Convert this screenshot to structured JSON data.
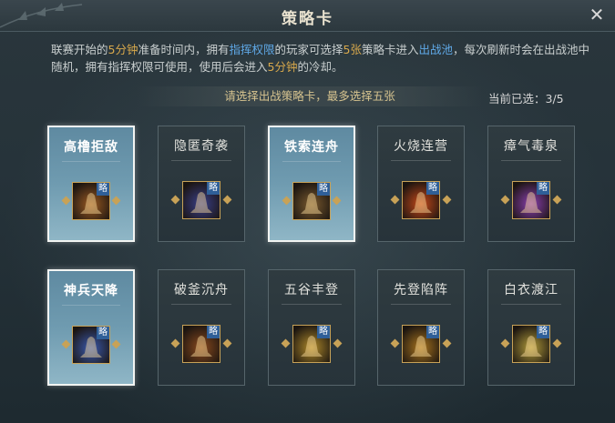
{
  "window": {
    "title": "策略卡"
  },
  "description": {
    "p1": "联赛开始的",
    "t1": "5分钟",
    "p2": "准备时间内，拥有",
    "t2": "指挥权限",
    "p3": "的玩家可选择",
    "t3": "5张",
    "p4": "策略卡进入",
    "t4": "出战池",
    "p5": "，每次刷新时会在出战池中随机，拥有指挥权限可使用，使用后会进入",
    "t5": "5分钟",
    "p6": "的冷却。"
  },
  "prompt": "请选择出战策略卡，最多选择五张",
  "selection": {
    "label": "当前已选：",
    "value": "3/5"
  },
  "badge_label": "略",
  "cards": [
    {
      "name": "高橹拒敌",
      "selected": true,
      "icon": "tower-icon",
      "hue": "#9a5a22"
    },
    {
      "name": "隐匿奇袭",
      "selected": false,
      "icon": "shadow-icon",
      "hue": "#3a3f8a"
    },
    {
      "name": "铁索连舟",
      "selected": true,
      "icon": "soldiers-icon",
      "hue": "#7a5a2e"
    },
    {
      "name": "火烧连营",
      "selected": false,
      "icon": "fire-icon",
      "hue": "#c4481a"
    },
    {
      "name": "瘴气毒泉",
      "selected": false,
      "icon": "poison-icon",
      "hue": "#8a3fb0"
    },
    {
      "name": "神兵天降",
      "selected": true,
      "icon": "descend-icon",
      "hue": "#3a5ab0"
    },
    {
      "name": "破釜沉舟",
      "selected": false,
      "icon": "cauldron-icon",
      "hue": "#8a4a1e"
    },
    {
      "name": "五谷丰登",
      "selected": false,
      "icon": "harvest-icon",
      "hue": "#b08a2a"
    },
    {
      "name": "先登陷阵",
      "selected": false,
      "icon": "charge-icon",
      "hue": "#a8741e"
    },
    {
      "name": "白衣渡江",
      "selected": false,
      "icon": "river-icon",
      "hue": "#b09a3a"
    }
  ]
}
